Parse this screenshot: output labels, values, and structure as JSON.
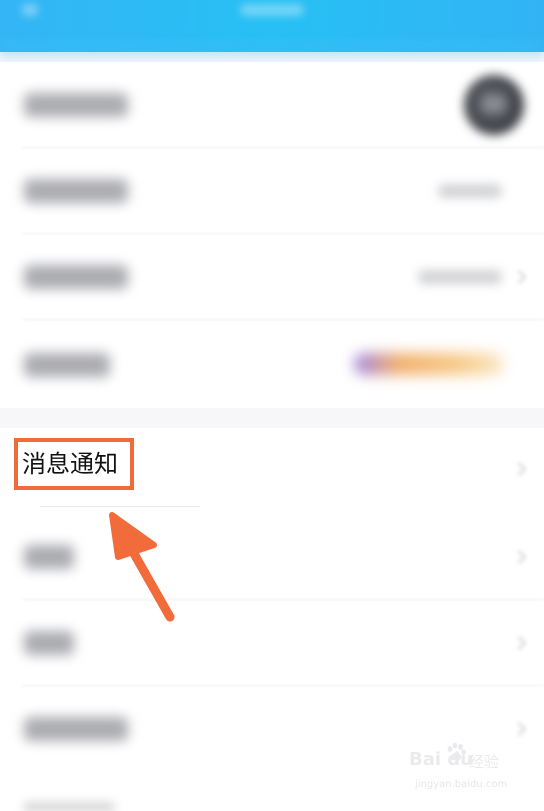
{
  "highlighted_item": {
    "label": "消息通知"
  },
  "watermark": {
    "brand": "Bai du",
    "sub": "经验",
    "url": "jingyan.baidu.com"
  },
  "colors": {
    "header_blue": "#27c0f4",
    "highlight_orange": "#f06a3a",
    "arrow_orange": "#f26b3a"
  },
  "icons": {
    "pointer": "arrow-pointer-icon",
    "avatar": "avatar",
    "chevron": "chevron-right-icon"
  }
}
